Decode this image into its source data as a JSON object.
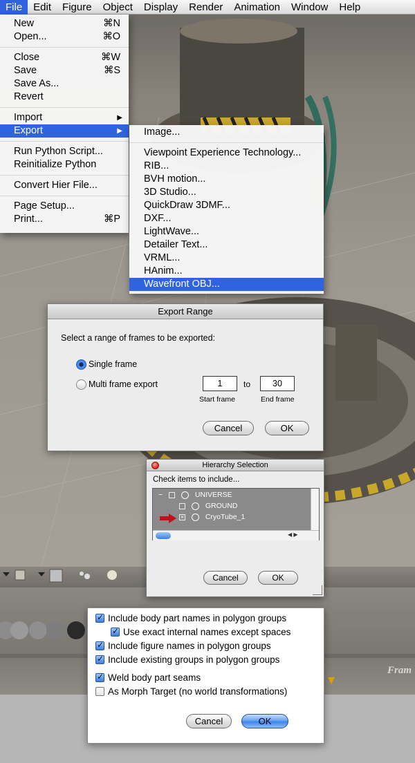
{
  "menubar": {
    "items": [
      "File",
      "Edit",
      "Figure",
      "Object",
      "Display",
      "Render",
      "Animation",
      "Window",
      "Help"
    ]
  },
  "file_menu": {
    "new": "New",
    "new_sc": "⌘N",
    "open": "Open...",
    "open_sc": "⌘O",
    "close": "Close",
    "close_sc": "⌘W",
    "save": "Save",
    "save_sc": "⌘S",
    "save_as": "Save As...",
    "revert": "Revert",
    "import": "Import",
    "export": "Export",
    "run_python": "Run Python Script...",
    "reinit_python": "Reinitialize Python",
    "convert_hier": "Convert Hier File...",
    "page_setup": "Page Setup...",
    "print": "Print...",
    "print_sc": "⌘P"
  },
  "export_menu": {
    "items": [
      "Image...",
      "Viewpoint Experience Technology...",
      "RIB...",
      "BVH motion...",
      "3D Studio...",
      "QuickDraw 3DMF...",
      "DXF...",
      "LightWave...",
      "Detailer Text...",
      "VRML...",
      "HAnim...",
      "Wavefront OBJ..."
    ]
  },
  "export_range": {
    "title": "Export Range",
    "prompt": "Select a range of frames to be exported:",
    "single": "Single frame",
    "multi": "Multi frame export",
    "start_value": "1",
    "to": "to",
    "end_value": "30",
    "start_label": "Start frame",
    "end_label": "End frame",
    "cancel": "Cancel",
    "ok": "OK"
  },
  "hierarchy": {
    "title": "Hierarchy Selection",
    "prompt": "Check items to include...",
    "rows": [
      {
        "name": "UNIVERSE",
        "expander": "−"
      },
      {
        "name": "GROUND"
      },
      {
        "name": "CryoTube_1"
      }
    ],
    "cancel": "Cancel",
    "ok": "OK"
  },
  "options": {
    "items": [
      {
        "label": "Include body part names in polygon groups",
        "checked": true
      },
      {
        "label": "Use exact internal names except spaces",
        "checked": true
      },
      {
        "label": "Include figure names in polygon groups",
        "checked": true
      },
      {
        "label": "Include existing groups in polygon groups",
        "checked": true
      },
      {
        "label": "Weld body part seams",
        "checked": true
      },
      {
        "label": "As Morph Target (no world transformations)",
        "checked": false
      }
    ],
    "cancel": "Cancel",
    "ok": "OK"
  },
  "background": {
    "frame_label": "Fram"
  },
  "colors": {
    "highlight": "#2f63e0",
    "arrow": "#c0121a"
  }
}
